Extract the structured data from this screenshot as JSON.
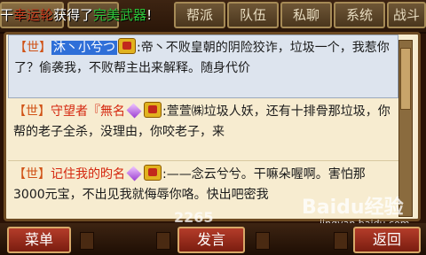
{
  "tabs": [
    {
      "label": ""
    },
    {
      "label": "帮派"
    },
    {
      "label": "队伍"
    },
    {
      "label": "私聊"
    },
    {
      "label": "系统"
    },
    {
      "label": "战斗"
    }
  ],
  "ticker": {
    "part1": "干",
    "part2": "幸运轮",
    "part3": "获得了",
    "part4": "完美武器",
    "part5": "!"
  },
  "messages": [
    {
      "channel": "【世】",
      "name": "沐丶小兮つ",
      "badges": [
        "vip-icon"
      ],
      "text": ":帝丶不败皇朝的阴险狡诈，垃圾一个，我惹你了？偷袭我，不败帮主出来解释。随身代价",
      "selected": true
    },
    {
      "channel": "【世】",
      "name": "守望者『無名",
      "badges": [
        "gem-icon",
        "vip-icon"
      ],
      "text": ":萱萱㈱垃圾人妖，还有十排骨那垃圾，你帮的老子全杀，没理由，你咬老子，来",
      "selected": false
    },
    {
      "channel": "【世】",
      "name": "记住我的昀名",
      "badges": [
        "gem-icon",
        "vip-icon"
      ],
      "text": ":——念云兮兮。干嘛朵喔啊。害怕那3000元宝，不出见我就侮辱你咯。快出吧密我",
      "selected": false
    }
  ],
  "buttons": {
    "menu": "菜单",
    "send": "发言",
    "back": "返回"
  },
  "watermark": {
    "site": "2265",
    "logo": "Baidu经验",
    "url": "jingyan.baidu.com"
  },
  "colors": {
    "accent": "#d4260e",
    "selected_bg": "#dde4ee",
    "panel_bg": "#f7ecd0"
  }
}
